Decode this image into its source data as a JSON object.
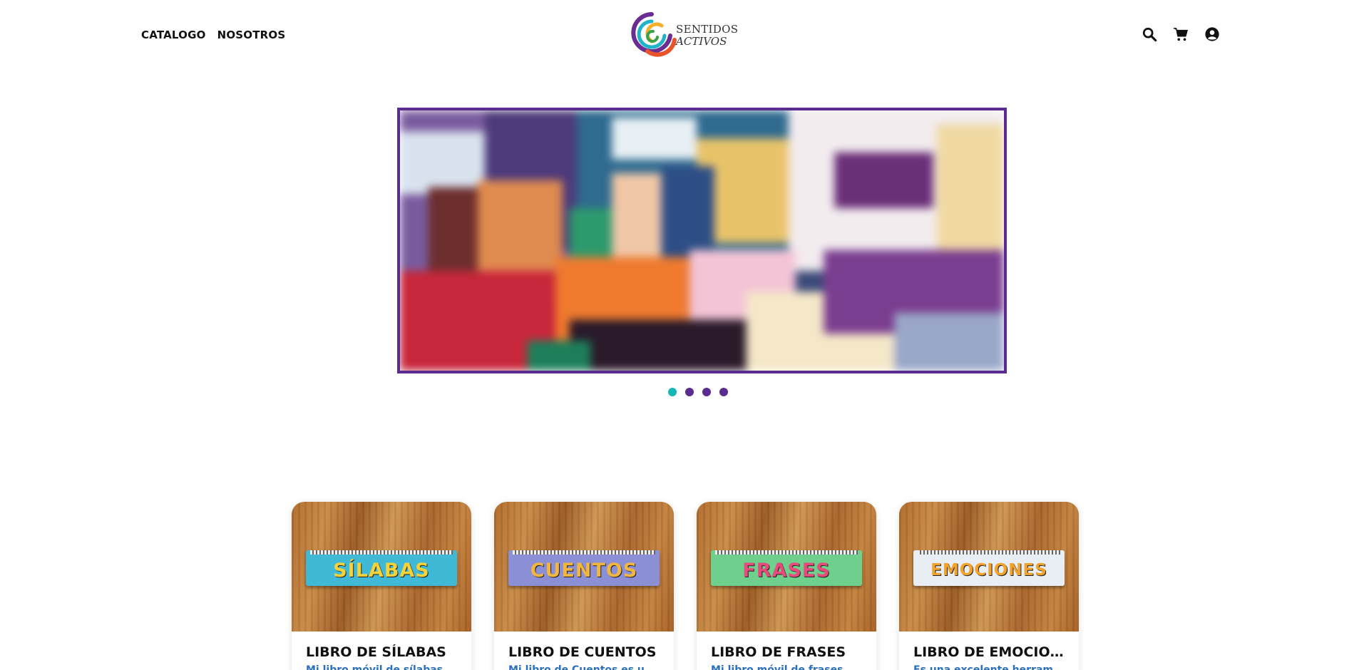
{
  "nav": {
    "items": [
      "CATALOGO",
      "NOSOTROS"
    ]
  },
  "logo": {
    "line1": "SENTIDOS",
    "line2": "ACTIVOS"
  },
  "header_icons": [
    "search-icon",
    "cart-icon",
    "user-icon"
  ],
  "carousel": {
    "slide_count": 4,
    "active_index": 0,
    "border_color": "#5b2c8f",
    "active_dot_color": "#17b6b6"
  },
  "products": [
    {
      "name": "LIBRO DE SÍLABAS",
      "description": "Mi libro móvil de sílabas es un recurso didáctico",
      "cover_word": "SÍLABAS",
      "cover_color": "#3fb9d6"
    },
    {
      "name": "LIBRO DE CUENTOS",
      "description": "Mi libro de Cuentos es una herramienta",
      "cover_word": "CUENTOS",
      "cover_color": "#8b8fd6"
    },
    {
      "name": "LIBRO DE FRASES",
      "description": "Mi libro móvil de frases es un recurso",
      "cover_word": "FRASES",
      "cover_color": "#6fcf8c"
    },
    {
      "name": "LIBRO DE EMOCIONES",
      "description": "Es una excelente herramienta para",
      "cover_word": "EMOCIONES",
      "cover_color": "#e9eef4"
    }
  ]
}
